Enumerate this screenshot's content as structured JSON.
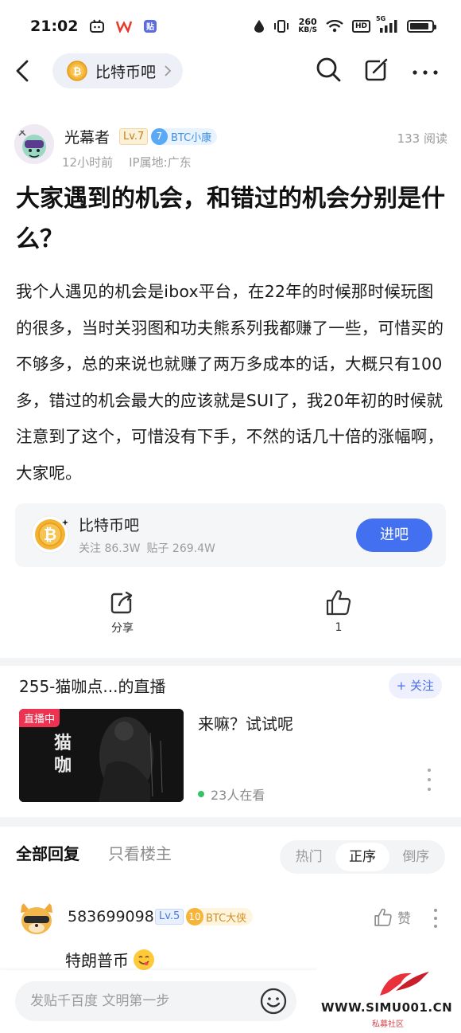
{
  "status_bar": {
    "time": "21:02",
    "net_speed_value": "260",
    "net_speed_unit": "KB/S",
    "hd": "HD",
    "signal": "5G"
  },
  "nav": {
    "forum_name": "比特币吧"
  },
  "post": {
    "author": "光幕者",
    "level": "Lv.7",
    "title_badge_num": "7",
    "title_badge": "BTC小康",
    "read_count": "133 阅读",
    "time_ago": "12小时前",
    "ip_location": "IP属地:广东",
    "title": "大家遇到的机会，和错过的机会分别是什么？",
    "body": "我个人遇见的机会是ibox平台，在22年的时候那时候玩图的很多，当时关羽图和功夫熊系列我都赚了一些，可惜买的不够多，总的来说也就赚了两万多成本的话，大概只有100多，错过的机会最大的应该就是SUI了，我20年初的时候就注意到了这个，可惜没有下手，不然的话几十倍的涨幅啊，大家呢。"
  },
  "forum_card": {
    "name": "比特币吧",
    "followers": "关注 86.3W",
    "posts": "贴子 269.4W",
    "enter_label": "进吧"
  },
  "actions": {
    "share_label": "分享",
    "like_count": "1"
  },
  "live": {
    "title": "255-猫咖点...的直播",
    "follow_label": "+ 关注",
    "tag": "直播中",
    "thumb_text": "猫咖",
    "caption": "来嘛？试试呢",
    "viewers": "23人在看"
  },
  "reply_tabs": {
    "all": "全部回复",
    "op_only": "只看楼主",
    "sort": [
      "热门",
      "正序",
      "倒序"
    ],
    "sort_selected": 1
  },
  "comment": {
    "user": "583699098",
    "level": "Lv.5",
    "badge_num": "10",
    "badge": "BTC大侠",
    "like_label": "赞",
    "text": "特朗普币"
  },
  "bottom": {
    "input_placeholder": "发贴千百度 文明第一步"
  },
  "watermark": {
    "site": "WWW.SIMU001.CN",
    "sub": "私募社区"
  },
  "colors": {
    "primary_blue": "#4370f0",
    "live_red": "#ec3452",
    "gold": "#c2811c"
  }
}
